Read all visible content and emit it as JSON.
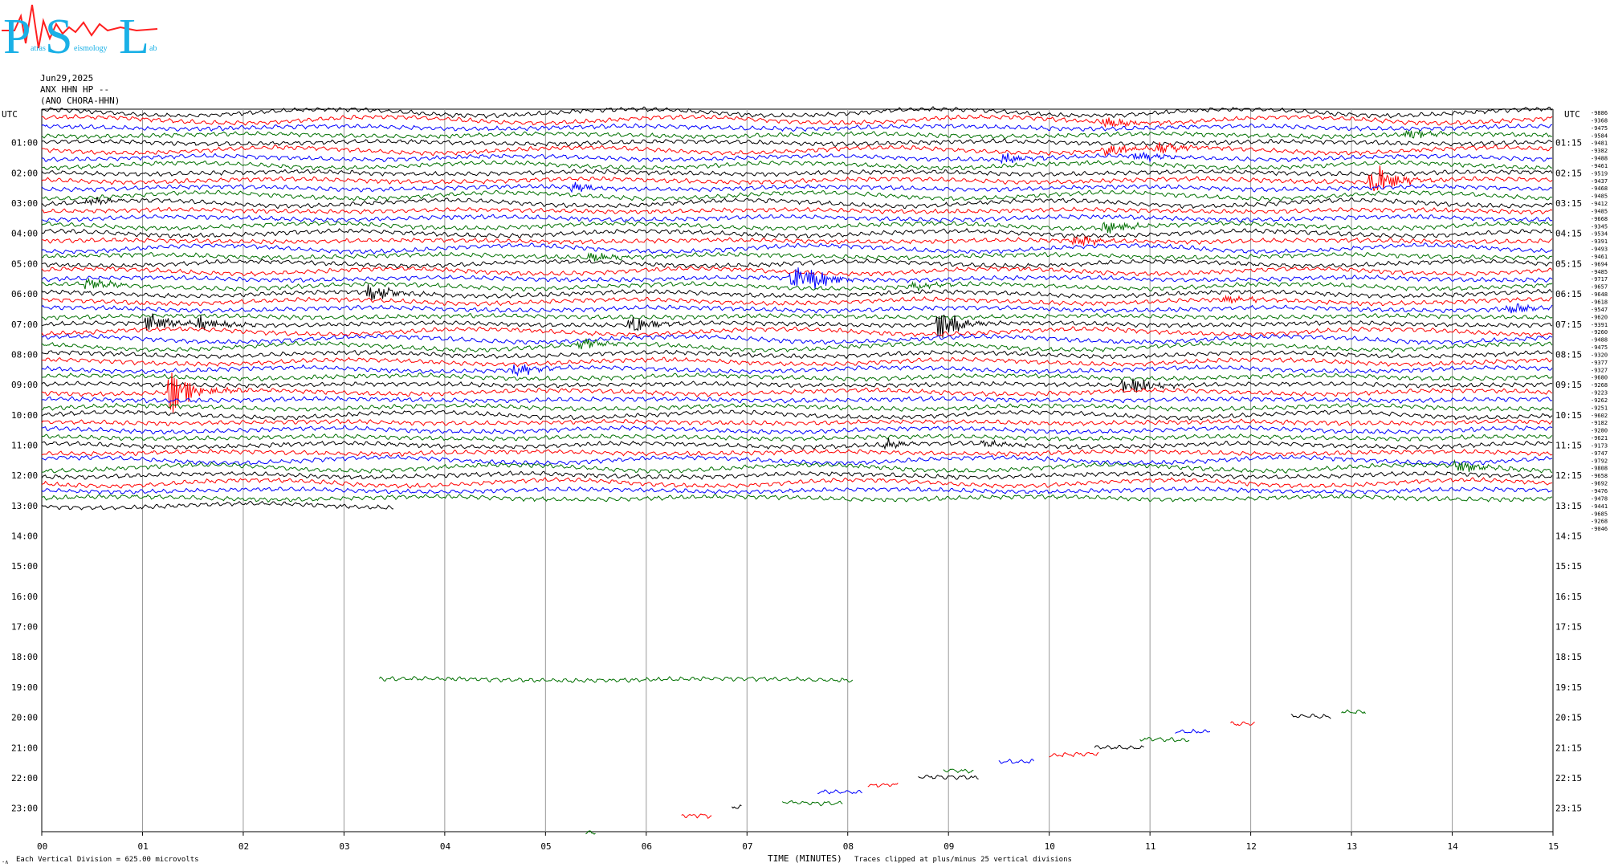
{
  "logo": {
    "letters": [
      "P",
      "S",
      "L"
    ],
    "small_text": [
      "atras",
      "eismology",
      "ab"
    ],
    "colors": {
      "letters": "#1ab0e6",
      "trace": "#ff2020"
    }
  },
  "header": {
    "date": "Jun29,2025",
    "station": "ANX HHN HP --",
    "location": "(ANO CHORA-HHN)"
  },
  "footer": {
    "scale_marker": "-∧",
    "vertical_division": "Each Vertical Division =  625.00 microvolts",
    "xlabel": "TIME (MINUTES)",
    "clip_note": "Traces clipped at plus/minus 25 vertical divisions"
  },
  "chart_data": {
    "type": "line",
    "title": "",
    "xlabel": "TIME (MINUTES)",
    "ylabel": "UTC",
    "right_ylabel": "UTC",
    "xlim": [
      0,
      15
    ],
    "x_ticks": [
      "00",
      "01",
      "02",
      "03",
      "04",
      "05",
      "06",
      "07",
      "08",
      "09",
      "10",
      "11",
      "12",
      "13",
      "14",
      "15"
    ],
    "y_ticks_left": [
      "01:00",
      "02:00",
      "03:00",
      "04:00",
      "05:00",
      "06:00",
      "07:00",
      "08:00",
      "09:00",
      "10:00",
      "11:00",
      "12:00",
      "13:00",
      "14:00",
      "15:00",
      "16:00",
      "17:00",
      "18:00",
      "19:00",
      "20:00",
      "21:00",
      "22:00",
      "23:00"
    ],
    "y_ticks_right": [
      "01:15",
      "02:15",
      "03:15",
      "04:15",
      "05:15",
      "06:15",
      "07:15",
      "08:15",
      "09:15",
      "10:15",
      "11:15",
      "12:15",
      "13:15",
      "14:15",
      "15:15",
      "16:15",
      "17:15",
      "18:15",
      "19:15",
      "20:15",
      "21:15",
      "22:15",
      "23:15"
    ],
    "rows_per_hour": 4,
    "minutes_per_row": 15,
    "color_cycle": [
      "#000000",
      "#ff0000",
      "#0000ff",
      "#007000"
    ],
    "grid": "vertical",
    "trace_end": {
      "row": 52,
      "minute": 3.5
    },
    "offsets": [
      "-9886",
      "-9368",
      "-9475",
      "-9584",
      "-9481",
      "-9382",
      "-9488",
      "-9461",
      "-9519",
      "-9437",
      "-9468",
      "-9485",
      "-9412",
      "-9485",
      "-9668",
      "-9345",
      "-9534",
      "-9391",
      "-9493",
      "-9461",
      "-9694",
      "-9485",
      "-9717",
      "-9657",
      "-9648",
      "-9618",
      "-9547",
      "-9620",
      "-9391",
      "-9260",
      "-9488",
      "-9475",
      "-9320",
      "-9377",
      "-9327",
      "-9680",
      "-9268",
      "-9223",
      "-9262",
      "-9251",
      "-9602",
      "-9182",
      "-9280",
      "-9621",
      "-9173",
      "-9747",
      "-9792",
      "-9808",
      "-9658",
      "-9692",
      "-9476",
      "-9478",
      "-9441",
      "-9685",
      "-9268",
      "-9046"
    ],
    "events": [
      {
        "row": 1,
        "minute": 10.6,
        "amplitude": 7
      },
      {
        "row": 3,
        "minute": 13.6,
        "amplitude": 7
      },
      {
        "row": 5,
        "minute": 10.6,
        "amplitude": 7
      },
      {
        "row": 5,
        "minute": 11.1,
        "amplitude": 9
      },
      {
        "row": 6,
        "minute": 9.6,
        "amplitude": 8
      },
      {
        "row": 6,
        "minute": 10.9,
        "amplitude": 7
      },
      {
        "row": 9,
        "minute": 13.25,
        "amplitude": 24
      },
      {
        "row": 10,
        "minute": 5.3,
        "amplitude": 6
      },
      {
        "row": 12,
        "minute": 0.5,
        "amplitude": 6
      },
      {
        "row": 15,
        "minute": 10.6,
        "amplitude": 9
      },
      {
        "row": 17,
        "minute": 10.3,
        "amplitude": 8
      },
      {
        "row": 19,
        "minute": 5.5,
        "amplitude": 6
      },
      {
        "row": 23,
        "minute": 8.7,
        "amplitude": 6
      },
      {
        "row": 22,
        "minute": 7.7,
        "amplitude": 10
      },
      {
        "row": 22,
        "minute": 7.5,
        "amplitude": 14
      },
      {
        "row": 24,
        "minute": 3.3,
        "amplitude": 12
      },
      {
        "row": 23,
        "minute": 0.5,
        "amplitude": 9
      },
      {
        "row": 26,
        "minute": 14.6,
        "amplitude": 7
      },
      {
        "row": 25,
        "minute": 11.8,
        "amplitude": 6
      },
      {
        "row": 28,
        "minute": 1.1,
        "amplitude": 14
      },
      {
        "row": 28,
        "minute": 1.6,
        "amplitude": 12
      },
      {
        "row": 28,
        "minute": 5.9,
        "amplitude": 10
      },
      {
        "row": 28,
        "minute": 8.95,
        "amplitude": 20
      },
      {
        "row": 31,
        "minute": 5.4,
        "amplitude": 7
      },
      {
        "row": 34,
        "minute": 4.75,
        "amplitude": 8
      },
      {
        "row": 36,
        "minute": 10.8,
        "amplitude": 14
      },
      {
        "row": 37,
        "minute": 1.3,
        "amplitude": 34
      },
      {
        "row": 44,
        "minute": 8.4,
        "amplitude": 6
      },
      {
        "row": 44,
        "minute": 9.4,
        "amplitude": 5
      },
      {
        "row": 47,
        "minute": 14.1,
        "amplitude": 8
      }
    ],
    "fragments": [
      {
        "row": 75,
        "from": 3.35,
        "to": 8.05
      },
      {
        "row": 80,
        "from": 12.4,
        "to": 12.8
      },
      {
        "row": 79,
        "from": 12.9,
        "to": 13.15
      },
      {
        "row": 81,
        "from": 11.8,
        "to": 12.05
      },
      {
        "row": 82,
        "from": 11.25,
        "to": 11.6
      },
      {
        "row": 83,
        "from": 10.9,
        "to": 11.4
      },
      {
        "row": 84,
        "from": 10.45,
        "to": 10.95
      },
      {
        "row": 85,
        "from": 10.0,
        "to": 10.5
      },
      {
        "row": 86,
        "from": 9.5,
        "to": 9.85
      },
      {
        "row": 87,
        "from": 8.95,
        "to": 9.25
      },
      {
        "row": 88,
        "from": 8.7,
        "to": 9.3
      },
      {
        "row": 89,
        "from": 8.2,
        "to": 8.5
      },
      {
        "row": 90,
        "from": 7.7,
        "to": 8.15
      },
      {
        "row": 91,
        "from": 7.35,
        "to": 7.95
      },
      {
        "row": 92,
        "from": 6.85,
        "to": 6.95
      },
      {
        "row": 93,
        "from": 6.35,
        "to": 6.65
      },
      {
        "row": 95,
        "from": 5.4,
        "to": 5.5
      }
    ]
  }
}
